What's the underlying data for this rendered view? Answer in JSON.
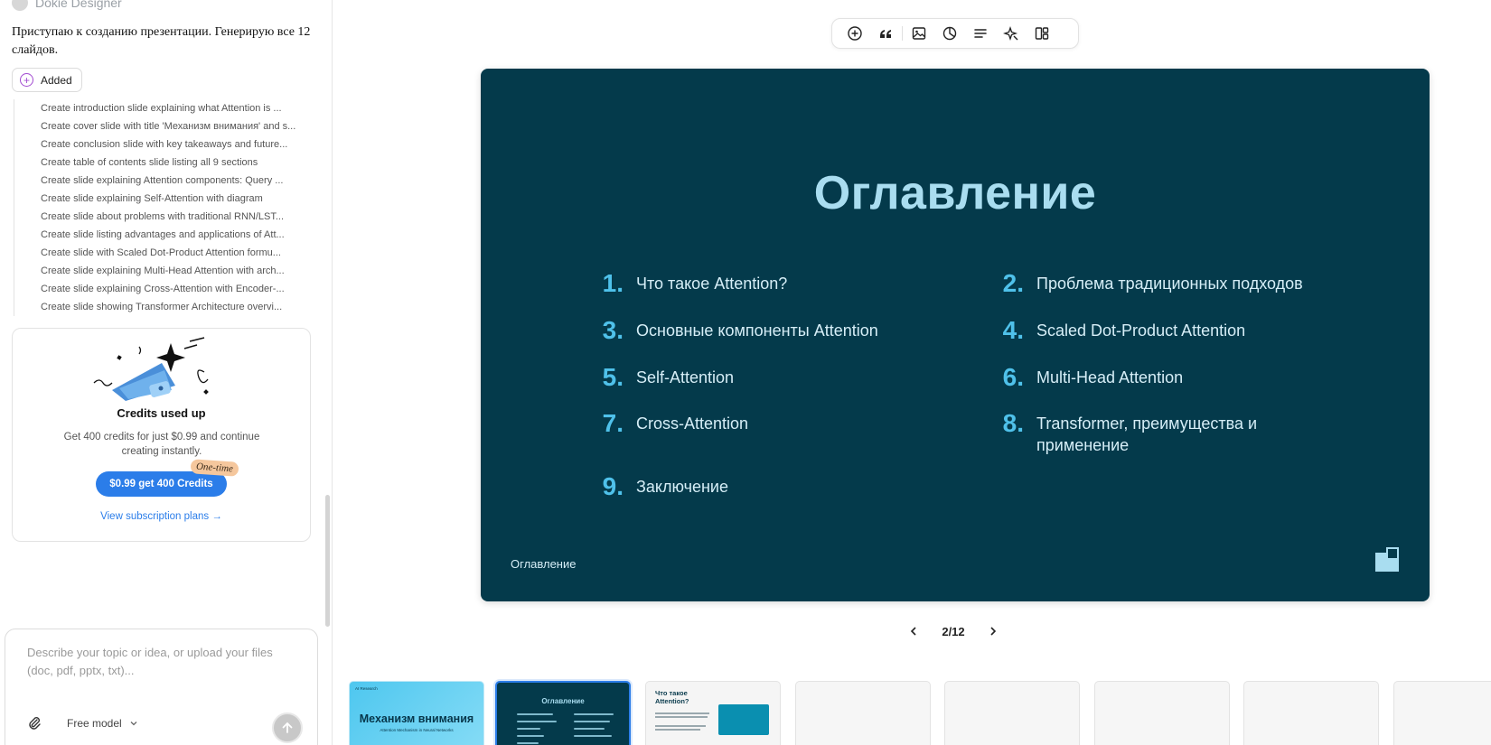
{
  "sidebar": {
    "assistant_name": "Dokie Designer",
    "message": "Приступаю к созданию презентации. Генерирую все 12 слайдов.",
    "added_label": "Added",
    "tasks": [
      "Create introduction slide explaining what Attention is ...",
      "Create cover slide with title 'Механизм внимания' and s...",
      "Create conclusion slide with key takeaways and future...",
      "Create table of contents slide listing all 9 sections",
      "Create slide explaining Attention components: Query ...",
      "Create slide explaining Self-Attention with diagram",
      "Create slide about problems with traditional RNN/LST...",
      "Create slide listing advantages and applications of Att...",
      "Create slide with Scaled Dot-Product Attention formu...",
      "Create slide explaining Multi-Head Attention with arch...",
      "Create slide explaining Cross-Attention with Encoder-...",
      "Create slide showing Transformer Architecture overvi..."
    ],
    "credits": {
      "title": "Credits used up",
      "description": "Get 400 credits for just $0.99 and continue creating instantly.",
      "buy_label": "$0.99 get 400 Credits",
      "badge": "One-time",
      "plans_link": "View subscription plans →"
    },
    "composer": {
      "placeholder": "Describe your topic or idea, or upload your files (doc, pdf, pptx, txt)...",
      "model_label": "Free model"
    }
  },
  "toolbar": {
    "icons": [
      "add-icon",
      "quote-icon",
      "image-icon",
      "chart-icon",
      "text-align-icon",
      "magic-icon",
      "layout-icon"
    ]
  },
  "slide": {
    "title": "Оглавление",
    "items": [
      {
        "num": "1.",
        "text": "Что такое Attention?"
      },
      {
        "num": "2.",
        "text": "Проблема традиционных подходов"
      },
      {
        "num": "3.",
        "text": "Основные компоненты Attention"
      },
      {
        "num": "4.",
        "text": "Scaled Dot-Product Attention"
      },
      {
        "num": "5.",
        "text": "Self-Attention"
      },
      {
        "num": "6.",
        "text": "Multi-Head Attention"
      },
      {
        "num": "7.",
        "text": "Cross-Attention"
      },
      {
        "num": "8.",
        "text": "Transformer, преимущества и применение"
      },
      {
        "num": "9.",
        "text": "Заключение"
      }
    ],
    "footer": "Оглавление",
    "colors": {
      "background": "#043a4b",
      "title": "#a9ddf0",
      "number": "#4fc1ea",
      "text": "#d6eef7"
    }
  },
  "pager": {
    "label": "2/12"
  },
  "thumbnails": {
    "t1_title": "Механизм внимания",
    "t1_subtitle": "Attention Mechanism in Neural Networks",
    "t1_logo": "AI Research",
    "t2_title": "Оглавление",
    "t3_title": "Что такое Attention?"
  }
}
